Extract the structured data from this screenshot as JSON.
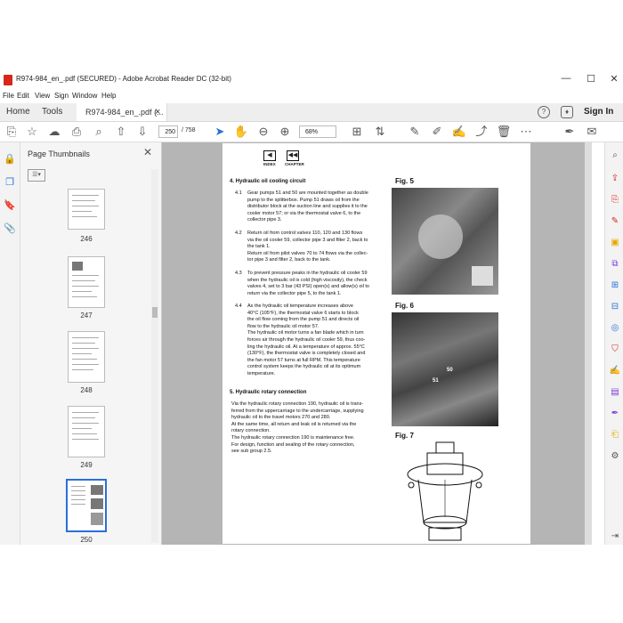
{
  "window": {
    "title": "R974-984_en_.pdf (SECURED) - Adobe Acrobat Reader DC (32-bit)",
    "minimize": "—",
    "maximize": "☐",
    "close": "✕"
  },
  "menu": [
    "File",
    "Edit",
    "View",
    "Sign",
    "Window",
    "Help"
  ],
  "tabs": {
    "home": "Home",
    "tools": "Tools",
    "document": "R974-984_en_.pdf (...",
    "close": "×",
    "sign_in": "Sign In"
  },
  "toolbar": {
    "current_page": "250",
    "total_pages": "/ 758",
    "zoom": "68%"
  },
  "thumbnails": {
    "header": "Page Thumbnails",
    "pages": [
      "246",
      "247",
      "248",
      "249",
      "250"
    ]
  },
  "document": {
    "nav_index": "INDEX",
    "nav_chapter": "CHAPTER",
    "section4_title": "4. Hydraulic oil cooling circuit",
    "p41_num": "4.1",
    "p41_lines": [
      "Gear pumps 51 and 50 are mounted together as double",
      "pump to the splitterbox. Pump 51 draws oil from the",
      "distributor block at the suction line and supplies it to the",
      "cooler motor 57; or via the thermostat valve 6, to the",
      "collector pipe 3."
    ],
    "p42_num": "4.2",
    "p42_lines": [
      "Return oil from control valves 110, 120 and 130 flows",
      "via the oil cooler 59, collector pipe 3 and filter 2, back to",
      "the tank 1.",
      "Return oil from pilot valves 70 to 74 flows via the collec-",
      "tor pipe 3 and filter 2, back to the tank."
    ],
    "p43_num": "4.3",
    "p43_lines": [
      "To prevent pressure peaks in the hydraulic oil cooler 59",
      "when the hydraulic oil is cold (high viscosity), the check",
      "valves 4, set to 3 bar (43 PSI) open(s) and allow(s) oil to",
      "return via the collector pipe 5, to the tank 1."
    ],
    "p44_num": "4.4",
    "p44_lines": [
      "As the hydraulic oil temperature increases above",
      "40°C (105°F), the thermostat valve 6 starts to block",
      "the oil flow coming from the pump 51 and directs oil",
      "flow to the hydraulic oil motor 57.",
      "The hydraulic oil motor turns a fan blade which in turn",
      "forces air through the hydraulic oil cooler 59, thus coo-",
      "ling the hydraulic oil. At a temperature of approx. 55°C",
      "(130°F), the thermostat valve is completely closed and",
      "the fan motor 57 turns at full RPM. This temperature",
      "control system keeps the hydraulic oil at its optimum",
      "temperature."
    ],
    "section5_title": "5. Hydraulic rotary connection",
    "p5_lines": [
      "Via the hydraulic rotary connection 190, hydraulic oil is trans-",
      "ferred from the uppercarriage to the undercarriage, supplying",
      "hydraulic oil to the travel motors 270 and 280.",
      "At the same time, all return and leak oil is returned via the",
      "rotary connection.",
      "The hydraulic rotary connection 190 is maintenance free.",
      "For design, function and sealing of the rotary connection,",
      "see sub group 2.5."
    ],
    "fig5": "Fig. 5",
    "fig6": "Fig. 6",
    "fig7": "Fig. 7",
    "fig6_label_50": "50",
    "fig6_label_51": "51"
  }
}
